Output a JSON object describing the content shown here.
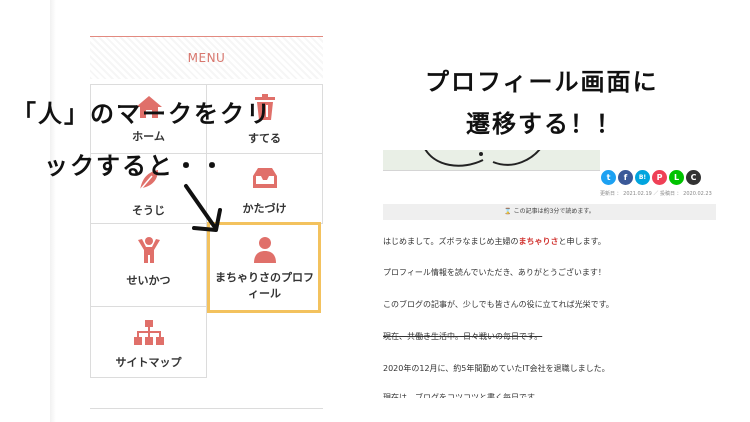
{
  "menu": {
    "title": "MENU",
    "items": [
      {
        "label": "ホーム",
        "icon": "home-icon"
      },
      {
        "label": "すてる",
        "icon": "trash-icon"
      },
      {
        "label": "そうじ",
        "icon": "leaf-icon"
      },
      {
        "label": "かたづけ",
        "icon": "tray-icon"
      },
      {
        "label": "せいかつ",
        "icon": "person-arms-up-icon"
      },
      {
        "label": "まちゃりさのプロフィール",
        "label_line1": "まちゃりさのプロフ",
        "label_line2": "ィール",
        "icon": "person-icon"
      },
      {
        "label": "サイトマップ",
        "icon": "sitemap-icon"
      }
    ],
    "accent_color": "#e0706a"
  },
  "annotation_left": {
    "line1": "「人」のマークをクリ",
    "line2": "ックすると・・"
  },
  "annotation_right": {
    "line1": "プロフィール画面に",
    "line2": "遷移する！！"
  },
  "blog": {
    "share_buttons": [
      {
        "name": "twitter",
        "glyph": "t",
        "color": "#1da1f2"
      },
      {
        "name": "facebook",
        "glyph": "f",
        "color": "#3b5998"
      },
      {
        "name": "hatena",
        "glyph": "B!",
        "color": "#00a4de"
      },
      {
        "name": "pocket",
        "glyph": "P",
        "color": "#ef4056"
      },
      {
        "name": "line",
        "glyph": "L",
        "color": "#00c300"
      },
      {
        "name": "copy",
        "glyph": "C",
        "color": "#333333"
      }
    ],
    "dates": "更新日 ： 2021.02.19 ／ 投稿日 ： 2020.02.23",
    "read_time": "⌛ この記事は約3分で読めます。",
    "paragraphs": {
      "p1_a": "はじめまして。ズボラなまじめ主婦の",
      "p1_name": "まちゃりさ",
      "p1_b": "と申します。",
      "p2": "プロフィール情報を読んでいただき、ありがとうございます！",
      "p3": "このブログの記事が、少しでも皆さんの役に立てれば光栄です。",
      "p4": "現在、共働き生活中。日々戦いの毎日です。",
      "p5": "2020年の12月に、約5年間勤めていたIT会社を退職しました。",
      "p6": "現在は、ブログをコツコツと書く毎日です。"
    }
  }
}
